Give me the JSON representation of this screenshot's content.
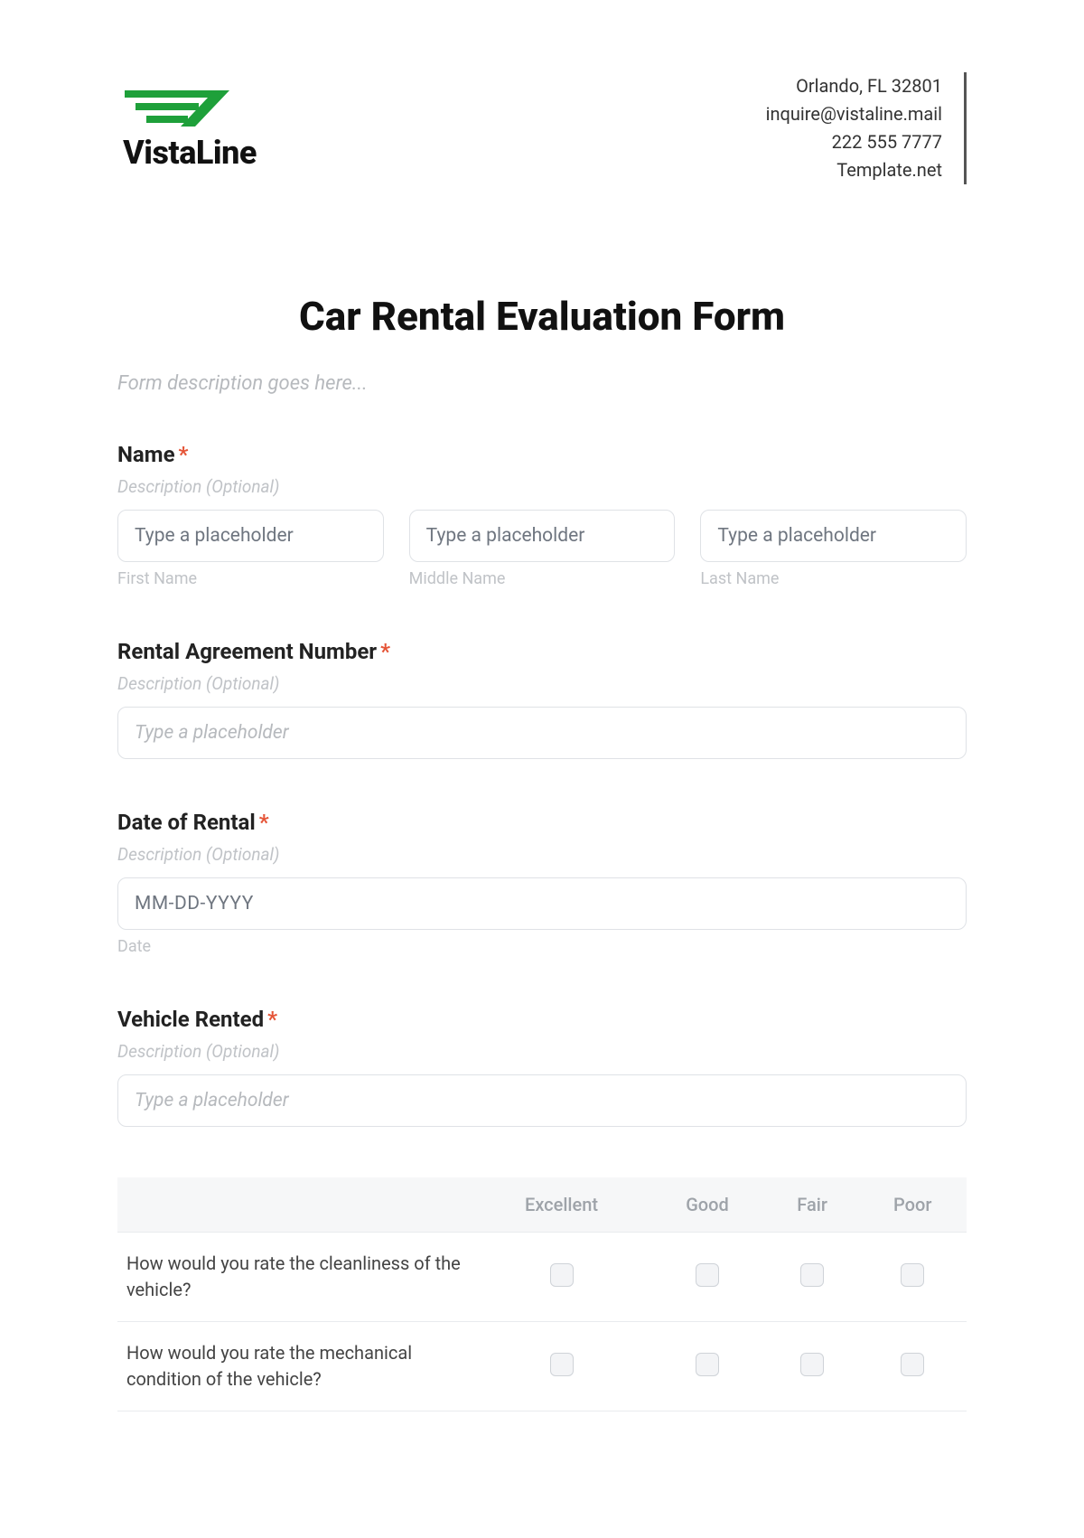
{
  "header": {
    "brand": "VistaLine",
    "contact": {
      "address": "Orlando, FL 32801",
      "email": "inquire@vistaline.mail",
      "phone": "222 555 7777",
      "site": "Template.net"
    }
  },
  "form": {
    "title": "Car Rental Evaluation Form",
    "description_placeholder": "Form description goes here...",
    "desc_optional": "Description (Optional)",
    "placeholder_text": "Type a placeholder",
    "date_placeholder": "MM-DD-YYYY",
    "fields": {
      "name": {
        "label": "Name",
        "required_mark": "*",
        "subs": {
          "first": "First Name",
          "middle": "Middle Name",
          "last": "Last Name"
        }
      },
      "agreement": {
        "label": "Rental Agreement Number",
        "required_mark": "*"
      },
      "date": {
        "label": "Date of Rental",
        "required_mark": "*",
        "sub": "Date"
      },
      "vehicle": {
        "label": "Vehicle Rented",
        "required_mark": "*"
      }
    },
    "rating": {
      "columns": [
        "Excellent",
        "Good",
        "Fair",
        "Poor"
      ],
      "questions": [
        "How would you rate the cleanliness of the vehicle?",
        "How would you rate the mechanical condition of the vehicle?"
      ]
    }
  }
}
